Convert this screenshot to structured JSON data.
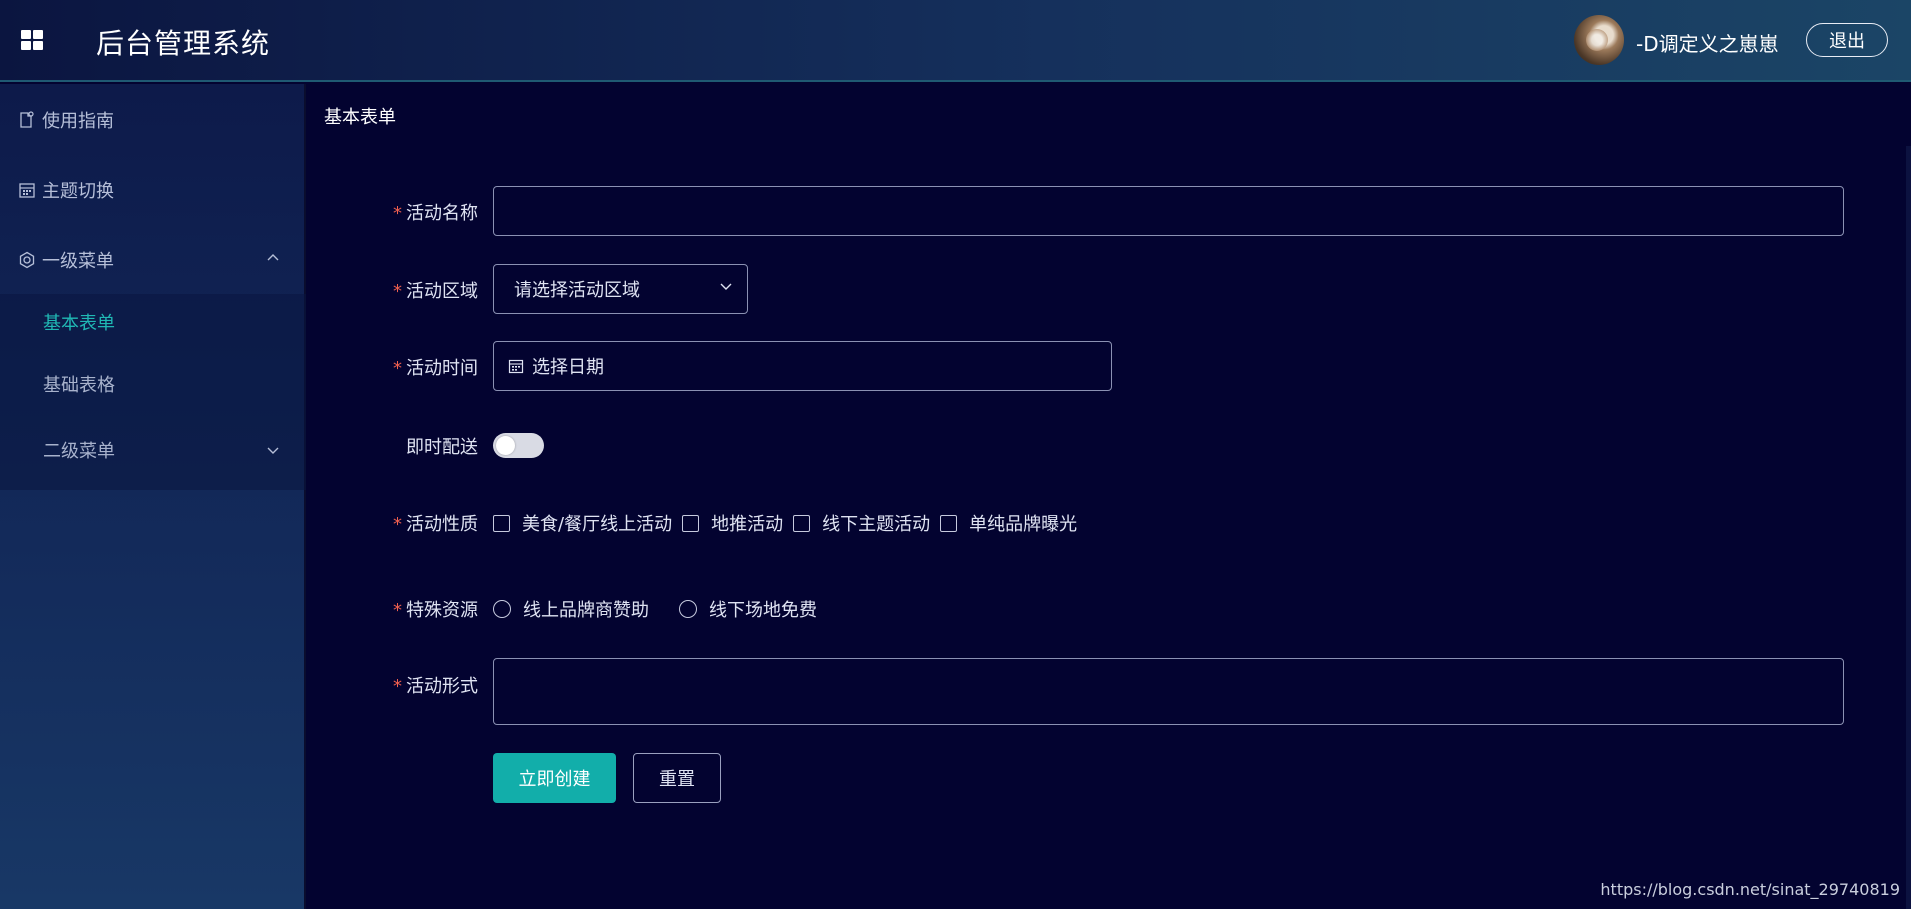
{
  "header": {
    "app_title": "后台管理系统",
    "username": "-D调定义之崽崽",
    "logout_label": "退出"
  },
  "sidebar": {
    "items": [
      {
        "label": "使用指南",
        "icon": "guide-icon"
      },
      {
        "label": "主题切换",
        "icon": "calendar-icon"
      },
      {
        "label": "一级菜单",
        "icon": "setting-icon",
        "expanded": true
      }
    ],
    "submenu": [
      {
        "label": "基本表单",
        "active": true
      },
      {
        "label": "基础表格",
        "active": false
      },
      {
        "label": "二级菜单",
        "expanded": false
      }
    ]
  },
  "breadcrumb": "基本表单",
  "form": {
    "name_label": "活动名称",
    "name_value": "",
    "region_label": "活动区域",
    "region_placeholder": "请选择活动区域",
    "time_label": "活动时间",
    "time_placeholder": "选择日期",
    "delivery_label": "即时配送",
    "delivery_on": false,
    "type_label": "活动性质",
    "type_options": [
      "美食/餐厅线上活动",
      "地推活动",
      "线下主题活动",
      "单纯品牌曝光"
    ],
    "resource_label": "特殊资源",
    "resource_options": [
      "线上品牌商赞助",
      "线下场地免费"
    ],
    "desc_label": "活动形式",
    "desc_value": "",
    "submit_label": "立即创建",
    "reset_label": "重置"
  },
  "watermark": "https://blog.csdn.net/sinat_29740819",
  "colors": {
    "accent": "#12aeaa",
    "required": "#f0604f",
    "background": "#030330"
  }
}
